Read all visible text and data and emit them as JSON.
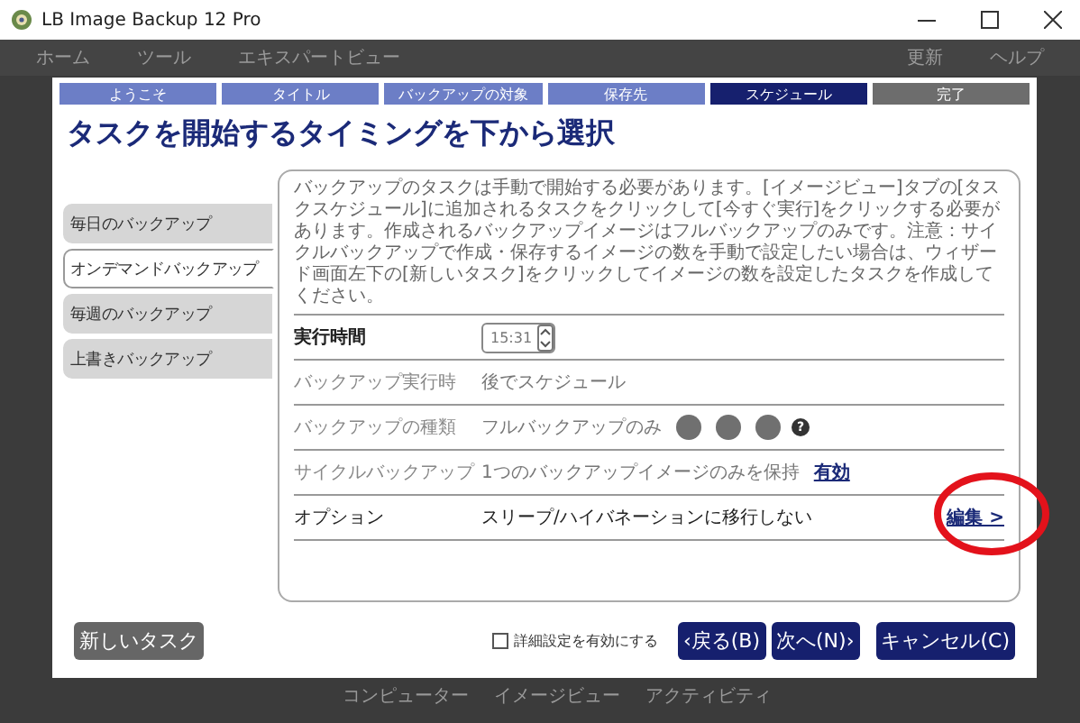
{
  "window": {
    "title": "LB Image Backup 12 Pro"
  },
  "background_app": {
    "menu": [
      "ホーム",
      "ツール",
      "エキスパートビュー"
    ],
    "menu_right": [
      "更新",
      "ヘルプ"
    ],
    "bottom_tabs": [
      "コンピューター",
      "イメージビュー",
      "アクティビティ"
    ]
  },
  "steps": [
    {
      "label": "ようこそ",
      "selected": false,
      "disabled": false
    },
    {
      "label": "タイトル",
      "selected": false,
      "disabled": false
    },
    {
      "label": "バックアップの対象",
      "selected": false,
      "disabled": false
    },
    {
      "label": "保存先",
      "selected": false,
      "disabled": false
    },
    {
      "label": "スケジュール",
      "selected": true,
      "disabled": false
    },
    {
      "label": "完了",
      "selected": false,
      "disabled": true
    }
  ],
  "heading": "タスクを開始するタイミングを下から選択",
  "schedule_tabs": [
    {
      "label": "毎日のバックアップ",
      "selected": false
    },
    {
      "label": "オンデマンドバックアップ",
      "selected": true
    },
    {
      "label": "毎週のバックアップ",
      "selected": false
    },
    {
      "label": "上書きバックアップ",
      "selected": false
    }
  ],
  "description": "バックアップのタスクは手動で開始する必要があります。[イメージビュー]タブの[タスクスケジュール]に追加されるタスクをクリックして[今すぐ実行]をクリックする必要があります。作成されるバックアップイメージはフルバックアップのみです。注意：サイクルバックアップで作成・保存するイメージの数を手動で設定したい場合は、ウィザード画面左下の[新しいタスク]をクリックしてイメージの数を設定したタスクを作成してください。",
  "rows": [
    {
      "kind": "time",
      "label": "実行時間",
      "value": "15:31",
      "disabled": false
    },
    {
      "kind": "text",
      "label": "バックアップ実行時",
      "value": "後でスケジュール",
      "disabled": true
    },
    {
      "kind": "dots",
      "label": "バックアップの種類",
      "value": "フルバックアップのみ",
      "help": "?",
      "disabled": true
    },
    {
      "kind": "link",
      "label": "サイクルバックアップ",
      "value": "1つのバックアップイメージのみを保持",
      "link": "有効",
      "disabled": true
    },
    {
      "kind": "edit",
      "label": "オプション",
      "value": "スリープ/ハイバネーションに移行しない",
      "link": "編集 >",
      "disabled": false,
      "highlighted": true
    }
  ],
  "footer": {
    "new_task": "新しいタスク",
    "advanced": {
      "label": "詳細設定を有効にする",
      "checked": false
    },
    "buttons": [
      "‹戻る(B)",
      "次へ(N)›",
      "キャンセル(C)"
    ]
  }
}
